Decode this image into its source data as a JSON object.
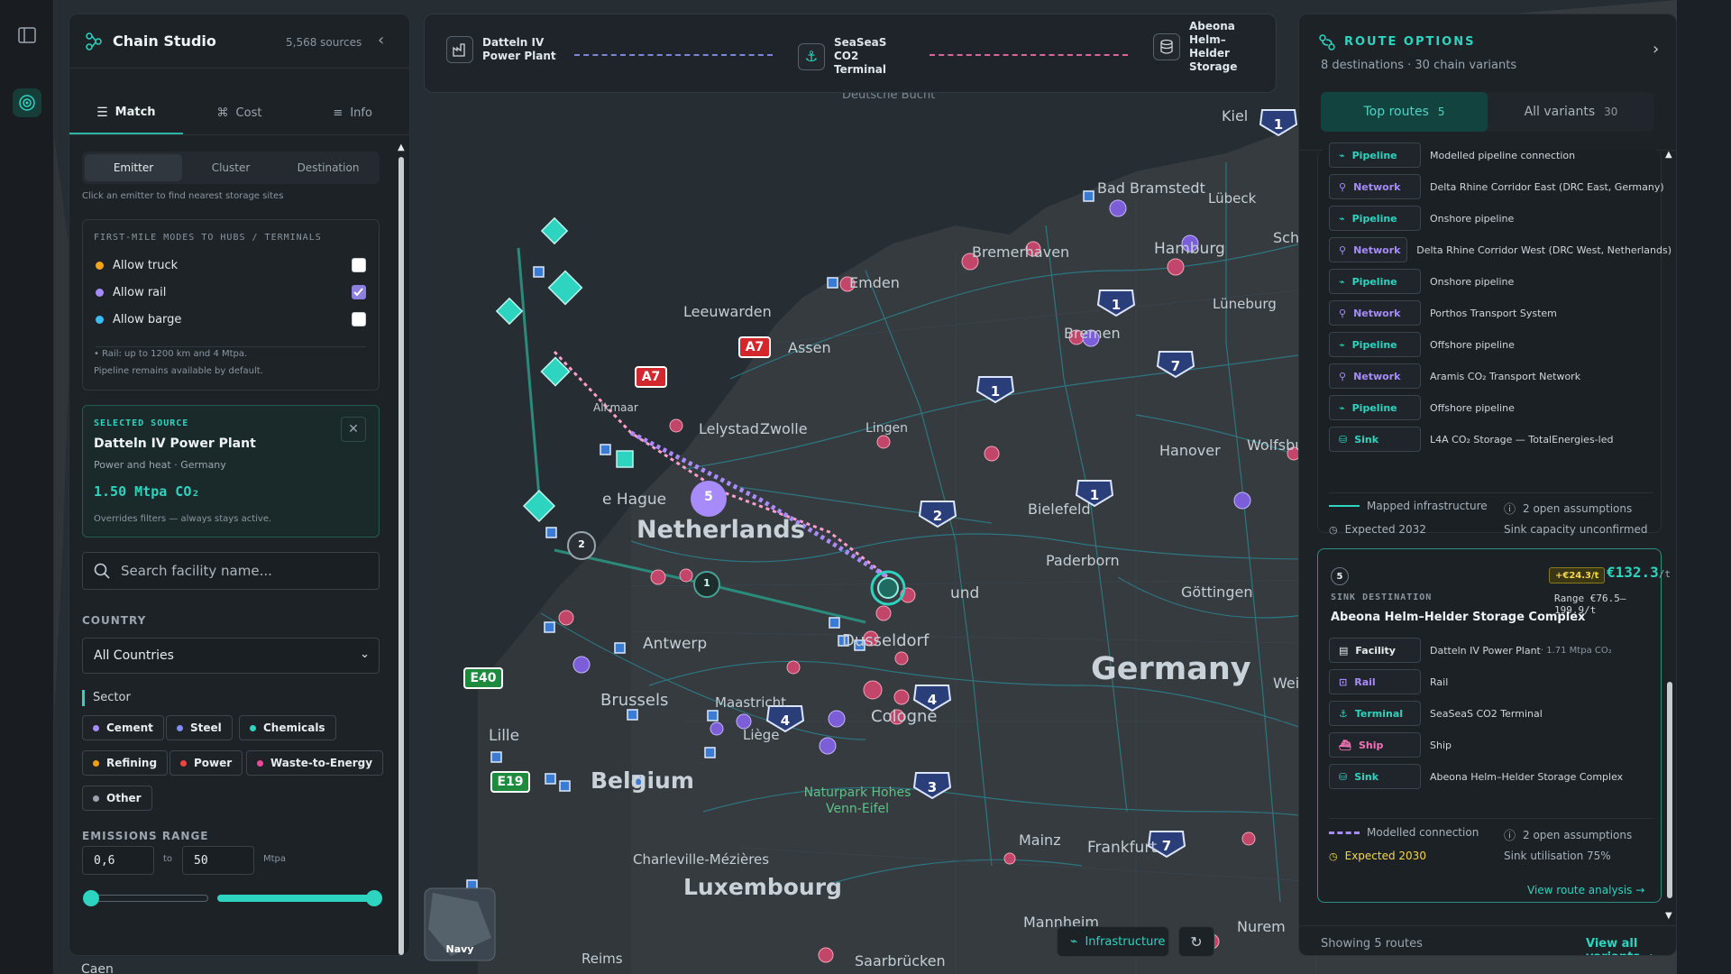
{
  "left_panel": {
    "title": "Chain Studio",
    "sources_count": "5,568 sources",
    "tabs": [
      {
        "label": "Match",
        "active": true
      },
      {
        "label": "Cost",
        "active": false
      },
      {
        "label": "Info",
        "active": false
      }
    ],
    "segment": [
      {
        "label": "Emitter",
        "active": true
      },
      {
        "label": "Cluster",
        "active": false
      },
      {
        "label": "Destination",
        "active": false
      }
    ],
    "hint": "Click an emitter to find nearest storage sites",
    "first_mile": {
      "heading": "First-mile modes to hubs / terminals",
      "options": [
        {
          "label": "Allow truck",
          "color": "#f0a31b",
          "checked": false
        },
        {
          "label": "Allow rail",
          "color": "#a78bfa",
          "checked": true
        },
        {
          "label": "Allow barge",
          "color": "#38bdf8",
          "checked": false
        }
      ],
      "note_1": "• Rail: up to 1200 km and 4 Mtpa.",
      "note_2": "Pipeline remains available by default."
    },
    "selected_source": {
      "heading": "Selected source",
      "name": "Datteln IV Power Plant",
      "subtitle": "Power and heat · Germany",
      "emission": "1.50 Mtpa CO₂",
      "note": "Overrides filters — always stays active."
    },
    "search": {
      "placeholder": "Search facility name..."
    },
    "country": {
      "label": "Country",
      "value": "All Countries"
    },
    "sector": {
      "label": "Sector",
      "chips": [
        {
          "label": "Cement",
          "color": "#a78bfa"
        },
        {
          "label": "Steel",
          "color": "#818cf8"
        },
        {
          "label": "Chemicals",
          "color": "#2dd4bf"
        },
        {
          "label": "Refining",
          "color": "#f59e0b"
        },
        {
          "label": "Power",
          "color": "#ef4444"
        },
        {
          "label": "Waste-to-Energy",
          "color": "#ec4899"
        },
        {
          "label": "Other",
          "color": "#9ca3af"
        }
      ]
    },
    "emissions_range": {
      "label": "Emissions range",
      "min": "0,6",
      "to": "to",
      "max": "50",
      "unit": "Mtpa"
    }
  },
  "chain_bar": {
    "source": "Datteln IV Power Plant",
    "terminal": "SeaSeaS CO2 Terminal",
    "storage": "Abeona Helm–Helder Storage"
  },
  "map": {
    "labels": {
      "netherlands": "Netherlands",
      "germany": "Germany",
      "belgium": "Belgium",
      "luxembourg": "Luxembourg",
      "deutsche_bucht": "Deutsche Bucht",
      "leeuwarden": "Leeuwarden",
      "emden": "Emden",
      "assen": "Assen",
      "bremerhaven": "Bremerhaven",
      "bad_bramstedt": "Bad Bramstedt",
      "lubeck": "Lübeck",
      "hamburg": "Hamburg",
      "luneburg": "Lüneburg",
      "bremen": "Bremen",
      "kiel": "Kiel",
      "lelystad": "Lelystad",
      "zwolle": "Zwolle",
      "lingen": "Lingen",
      "hanover": "Hanover",
      "wolfsburg": "Wolfsburg",
      "bielefeld": "Bielefeld",
      "paderborn": "Paderborn",
      "gottingen": "Göttingen",
      "den_haag": "e Hague",
      "dortmund": "und",
      "antwerp": "Antwerp",
      "dusseldorf": "Dusseldorf",
      "brussels": "Brussels",
      "maastricht": "Maastricht",
      "cologne": "Cologne",
      "liege": "Liège",
      "lille": "Lille",
      "naturpark": "Naturpark Hohes Venn-Eifel",
      "charleville": "Charleville-Mézières",
      "mainz": "Mainz",
      "frankfurt": "Frankfurt",
      "mannheim": "Mannheim",
      "saarbrucken": "Saarbrücken",
      "reims": "Reims",
      "caen": "Caen",
      "weim": "Weim",
      "nurem": "Nurem",
      "schw": "Schw",
      "alkmaar": "Alkmaar"
    },
    "road_shields": {
      "a7_1": "A7",
      "a7_2": "A7",
      "e40": "E40",
      "e19": "E19"
    },
    "cluster_count": "5",
    "route_markers": {
      "m1": "1",
      "m2": "2"
    },
    "minimap_label": "Navy",
    "infrastructure_button": "Infrastructure"
  },
  "right_panel": {
    "title": "Route options",
    "subtitle": "8 destinations · 30 chain variants",
    "tabs": [
      {
        "label": "Top routes",
        "count": "5",
        "active": true
      },
      {
        "label": "All variants",
        "count": "30",
        "active": false
      }
    ],
    "route_a_rows": [
      {
        "tag": "Pipeline",
        "kind": "pipeline",
        "desc": "Modelled pipeline connection"
      },
      {
        "tag": "Network",
        "kind": "network",
        "desc": "Delta Rhine Corridor East (DRC East, Germany)"
      },
      {
        "tag": "Pipeline",
        "kind": "pipeline",
        "desc": "Onshore pipeline"
      },
      {
        "tag": "Network",
        "kind": "network",
        "desc": "Delta Rhine Corridor West (DRC West, Netherlands)"
      },
      {
        "tag": "Pipeline",
        "kind": "pipeline",
        "desc": "Onshore pipeline"
      },
      {
        "tag": "Network",
        "kind": "network",
        "desc": "Porthos Transport System"
      },
      {
        "tag": "Pipeline",
        "kind": "pipeline",
        "desc": "Offshore pipeline"
      },
      {
        "tag": "Network",
        "kind": "network",
        "desc": "Aramis CO₂ Transport Network"
      },
      {
        "tag": "Pipeline",
        "kind": "pipeline",
        "desc": "Offshore pipeline"
      },
      {
        "tag": "Sink",
        "kind": "sink",
        "desc": "L4A CO₂ Storage — TotalEnergies-led"
      }
    ],
    "route_a_footer": {
      "infra": "Mapped infrastructure",
      "assumptions": "2 open assumptions",
      "expected": "Expected 2032",
      "capacity": "Sink capacity unconfirmed"
    },
    "route_b": {
      "rank": "5",
      "delta": "+€24.3/t",
      "price": "€132.3",
      "price_unit": "/t",
      "label": "Sink destination",
      "range": "Range €76.5–199.9/t",
      "name": "Abeona Helm–Helder Storage Complex",
      "rows": [
        {
          "tag": "Facility",
          "kind": "facility",
          "desc": "Datteln IV Power Plant",
          "extra": " · 1.71 Mtpa CO₂"
        },
        {
          "tag": "Rail",
          "kind": "rail",
          "desc": "Rail",
          "extra": ""
        },
        {
          "tag": "Terminal",
          "kind": "terminal",
          "desc": "SeaSeaS CO2 Terminal",
          "extra": ""
        },
        {
          "tag": "Ship",
          "kind": "ship",
          "desc": "Ship",
          "extra": ""
        },
        {
          "tag": "Sink",
          "kind": "sink",
          "desc": "Abeona Helm–Helder Storage Complex",
          "extra": ""
        }
      ],
      "connection": "Modelled connection",
      "assumptions": "2 open assumptions",
      "expected": "Expected 2030",
      "utilisation": "Sink utilisation 75%",
      "link": "View route analysis →"
    },
    "footer": {
      "showing": "Showing 5 routes",
      "view_all": "View all variants →"
    }
  }
}
